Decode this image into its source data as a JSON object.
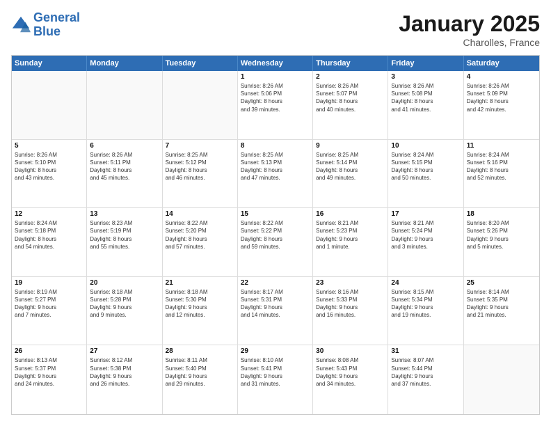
{
  "logo": {
    "line1": "General",
    "line2": "Blue"
  },
  "title": "January 2025",
  "location": "Charolles, France",
  "days": [
    "Sunday",
    "Monday",
    "Tuesday",
    "Wednesday",
    "Thursday",
    "Friday",
    "Saturday"
  ],
  "weeks": [
    [
      {
        "day": "",
        "info": ""
      },
      {
        "day": "",
        "info": ""
      },
      {
        "day": "",
        "info": ""
      },
      {
        "day": "1",
        "info": "Sunrise: 8:26 AM\nSunset: 5:06 PM\nDaylight: 8 hours\nand 39 minutes."
      },
      {
        "day": "2",
        "info": "Sunrise: 8:26 AM\nSunset: 5:07 PM\nDaylight: 8 hours\nand 40 minutes."
      },
      {
        "day": "3",
        "info": "Sunrise: 8:26 AM\nSunset: 5:08 PM\nDaylight: 8 hours\nand 41 minutes."
      },
      {
        "day": "4",
        "info": "Sunrise: 8:26 AM\nSunset: 5:09 PM\nDaylight: 8 hours\nand 42 minutes."
      }
    ],
    [
      {
        "day": "5",
        "info": "Sunrise: 8:26 AM\nSunset: 5:10 PM\nDaylight: 8 hours\nand 43 minutes."
      },
      {
        "day": "6",
        "info": "Sunrise: 8:26 AM\nSunset: 5:11 PM\nDaylight: 8 hours\nand 45 minutes."
      },
      {
        "day": "7",
        "info": "Sunrise: 8:25 AM\nSunset: 5:12 PM\nDaylight: 8 hours\nand 46 minutes."
      },
      {
        "day": "8",
        "info": "Sunrise: 8:25 AM\nSunset: 5:13 PM\nDaylight: 8 hours\nand 47 minutes."
      },
      {
        "day": "9",
        "info": "Sunrise: 8:25 AM\nSunset: 5:14 PM\nDaylight: 8 hours\nand 49 minutes."
      },
      {
        "day": "10",
        "info": "Sunrise: 8:24 AM\nSunset: 5:15 PM\nDaylight: 8 hours\nand 50 minutes."
      },
      {
        "day": "11",
        "info": "Sunrise: 8:24 AM\nSunset: 5:16 PM\nDaylight: 8 hours\nand 52 minutes."
      }
    ],
    [
      {
        "day": "12",
        "info": "Sunrise: 8:24 AM\nSunset: 5:18 PM\nDaylight: 8 hours\nand 54 minutes."
      },
      {
        "day": "13",
        "info": "Sunrise: 8:23 AM\nSunset: 5:19 PM\nDaylight: 8 hours\nand 55 minutes."
      },
      {
        "day": "14",
        "info": "Sunrise: 8:22 AM\nSunset: 5:20 PM\nDaylight: 8 hours\nand 57 minutes."
      },
      {
        "day": "15",
        "info": "Sunrise: 8:22 AM\nSunset: 5:22 PM\nDaylight: 8 hours\nand 59 minutes."
      },
      {
        "day": "16",
        "info": "Sunrise: 8:21 AM\nSunset: 5:23 PM\nDaylight: 9 hours\nand 1 minute."
      },
      {
        "day": "17",
        "info": "Sunrise: 8:21 AM\nSunset: 5:24 PM\nDaylight: 9 hours\nand 3 minutes."
      },
      {
        "day": "18",
        "info": "Sunrise: 8:20 AM\nSunset: 5:26 PM\nDaylight: 9 hours\nand 5 minutes."
      }
    ],
    [
      {
        "day": "19",
        "info": "Sunrise: 8:19 AM\nSunset: 5:27 PM\nDaylight: 9 hours\nand 7 minutes."
      },
      {
        "day": "20",
        "info": "Sunrise: 8:18 AM\nSunset: 5:28 PM\nDaylight: 9 hours\nand 9 minutes."
      },
      {
        "day": "21",
        "info": "Sunrise: 8:18 AM\nSunset: 5:30 PM\nDaylight: 9 hours\nand 12 minutes."
      },
      {
        "day": "22",
        "info": "Sunrise: 8:17 AM\nSunset: 5:31 PM\nDaylight: 9 hours\nand 14 minutes."
      },
      {
        "day": "23",
        "info": "Sunrise: 8:16 AM\nSunset: 5:33 PM\nDaylight: 9 hours\nand 16 minutes."
      },
      {
        "day": "24",
        "info": "Sunrise: 8:15 AM\nSunset: 5:34 PM\nDaylight: 9 hours\nand 19 minutes."
      },
      {
        "day": "25",
        "info": "Sunrise: 8:14 AM\nSunset: 5:35 PM\nDaylight: 9 hours\nand 21 minutes."
      }
    ],
    [
      {
        "day": "26",
        "info": "Sunrise: 8:13 AM\nSunset: 5:37 PM\nDaylight: 9 hours\nand 24 minutes."
      },
      {
        "day": "27",
        "info": "Sunrise: 8:12 AM\nSunset: 5:38 PM\nDaylight: 9 hours\nand 26 minutes."
      },
      {
        "day": "28",
        "info": "Sunrise: 8:11 AM\nSunset: 5:40 PM\nDaylight: 9 hours\nand 29 minutes."
      },
      {
        "day": "29",
        "info": "Sunrise: 8:10 AM\nSunset: 5:41 PM\nDaylight: 9 hours\nand 31 minutes."
      },
      {
        "day": "30",
        "info": "Sunrise: 8:08 AM\nSunset: 5:43 PM\nDaylight: 9 hours\nand 34 minutes."
      },
      {
        "day": "31",
        "info": "Sunrise: 8:07 AM\nSunset: 5:44 PM\nDaylight: 9 hours\nand 37 minutes."
      },
      {
        "day": "",
        "info": ""
      }
    ]
  ]
}
